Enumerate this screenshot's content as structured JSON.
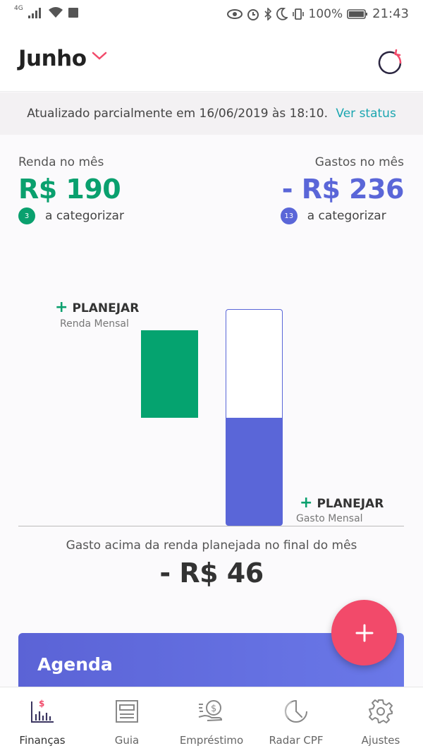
{
  "status_bar": {
    "network": "4G",
    "battery": "100%",
    "time": "21:43"
  },
  "header": {
    "month": "Junho"
  },
  "notice": {
    "text": "Atualizado parcialmente em 16/06/2019 às 18:10.",
    "link": "Ver status"
  },
  "income": {
    "label": "Renda no mês",
    "value": "R$ 190",
    "badge_count": "3",
    "badge_text": "a categorizar"
  },
  "expense": {
    "label": "Gastos no mês",
    "value": "- R$ 236",
    "badge_count": "13",
    "badge_text": "a categorizar"
  },
  "chart": {
    "income_plan_plus": "+",
    "income_plan_label": "PLANEJAR",
    "income_plan_sub": "Renda Mensal",
    "expense_plan_plus": "+",
    "expense_plan_label": "PLANEJAR",
    "expense_plan_sub": "Gasto Mensal"
  },
  "chart_data": {
    "type": "bar",
    "categories": [
      "Renda",
      "Gastos"
    ],
    "values": [
      190,
      236
    ],
    "title": "",
    "xlabel": "",
    "ylabel": ""
  },
  "result": {
    "label": "Gasto acima da renda planejada no final do mês",
    "value": "- R$ 46"
  },
  "agenda": {
    "title": "Agenda"
  },
  "fab": {
    "icon": "plus-icon"
  },
  "nav": {
    "items": [
      {
        "label": "Finanças",
        "icon": "finance-chart-icon"
      },
      {
        "label": "Guia",
        "icon": "guide-icon"
      },
      {
        "label": "Empréstimo",
        "icon": "loan-icon"
      },
      {
        "label": "Radar CPF",
        "icon": "radar-icon"
      },
      {
        "label": "Ajustes",
        "icon": "settings-gear-icon"
      }
    ]
  },
  "colors": {
    "green": "#0aa06e",
    "blue": "#5a66d8",
    "accent": "#f24a6a",
    "link": "#1ba6b0"
  }
}
